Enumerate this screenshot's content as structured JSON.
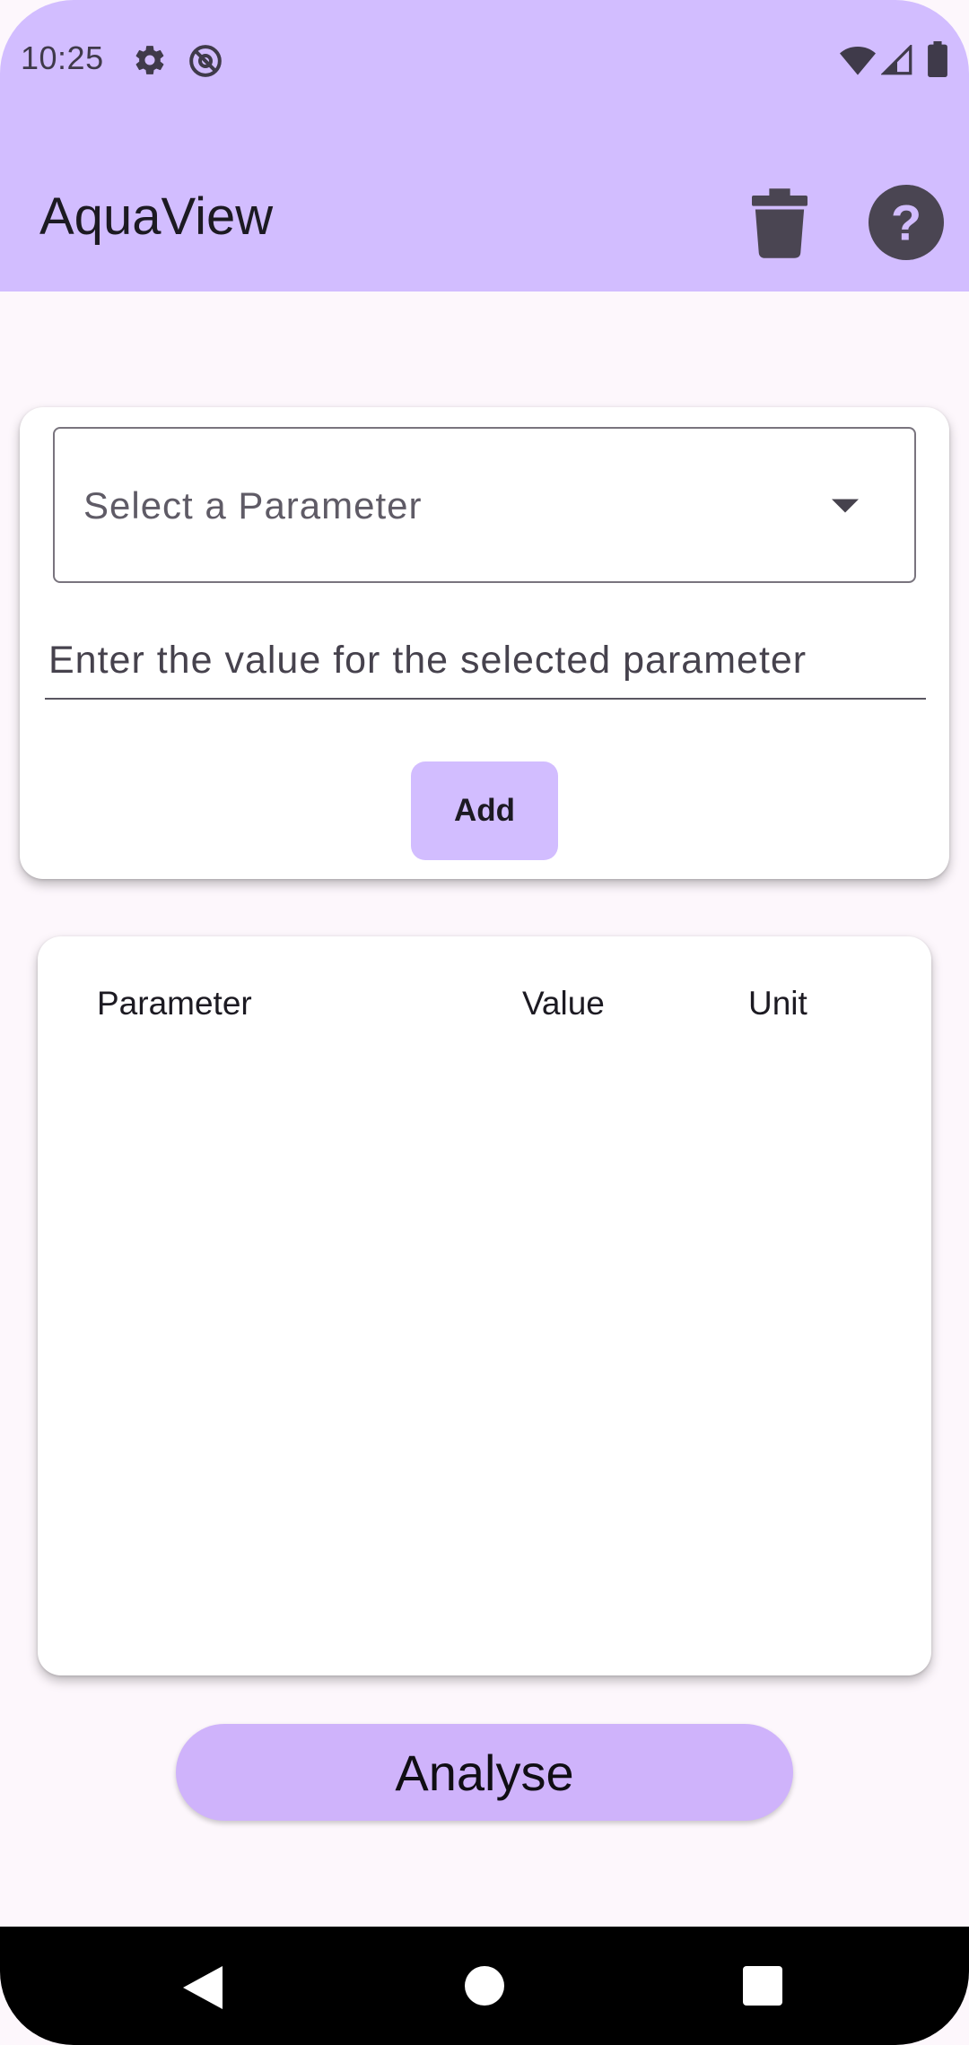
{
  "status_bar": {
    "time": "10:25",
    "icons_left": [
      "gear-icon",
      "at-sign-icon"
    ],
    "icons_right": [
      "wifi-icon",
      "cell-signal-icon",
      "battery-icon"
    ]
  },
  "app_bar": {
    "title": "AquaView",
    "actions": [
      "delete-icon",
      "help-icon"
    ]
  },
  "input_card": {
    "dropdown_placeholder": "Select a Parameter",
    "value_placeholder": "Enter the value for the selected parameter",
    "add_label": "Add"
  },
  "table": {
    "headers": [
      "Parameter",
      "Value",
      "Unit"
    ],
    "rows": []
  },
  "analyse_label": "Analyse",
  "nav_bar": {
    "buttons": [
      "back-icon",
      "home-icon",
      "recents-icon"
    ]
  },
  "colors": {
    "accent": "#d2bdff",
    "background": "#fdf7fc",
    "button": "#cfb3fb"
  }
}
